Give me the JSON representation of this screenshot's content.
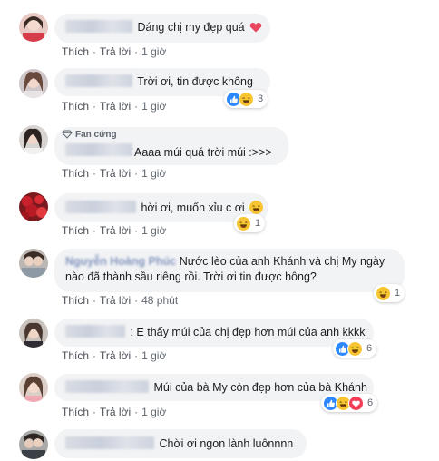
{
  "labels": {
    "like": "Thích",
    "reply": "Trả lời",
    "sep": "·"
  },
  "comments": [
    {
      "text": "Dáng chị my đẹp quá",
      "time": "1 giờ"
    },
    {
      "text": "Trời ơi, tin được không",
      "time": "1 giờ",
      "reaction_count": "3"
    },
    {
      "badge": "Fan cứng",
      "text": "Aaaa múi quá trời múi :>>>",
      "time": "1 giờ"
    },
    {
      "text": "hời ơi, muốn xỉu c ơi",
      "time": "1 giờ",
      "reaction_count": "1"
    },
    {
      "name_partial": "Nguyễn Hoàng Phúc",
      "text_line1": "Nước lèo của anh Khánh và chị My ngày",
      "text_line2": "nào đã thành sầu riêng rồi. Trời ơi tin được hông?",
      "time": "48 phút",
      "reaction_count": "1"
    },
    {
      "text": ": E thấy múi của chị đẹp hơn múi của anh kkkk",
      "time": "1 giờ",
      "reaction_count": "6"
    },
    {
      "text": "Múi của bà My còn đẹp hơn của bà Khánh",
      "time": "1 giờ",
      "reaction_count": "6"
    },
    {
      "text": "Chời ơi ngon lành luônnnn"
    }
  ],
  "colors": {
    "bubble": "#f2f3f5",
    "like": "#2d88ff",
    "haha": "#f7c531",
    "love": "#f33e58",
    "meta": "#606770"
  }
}
